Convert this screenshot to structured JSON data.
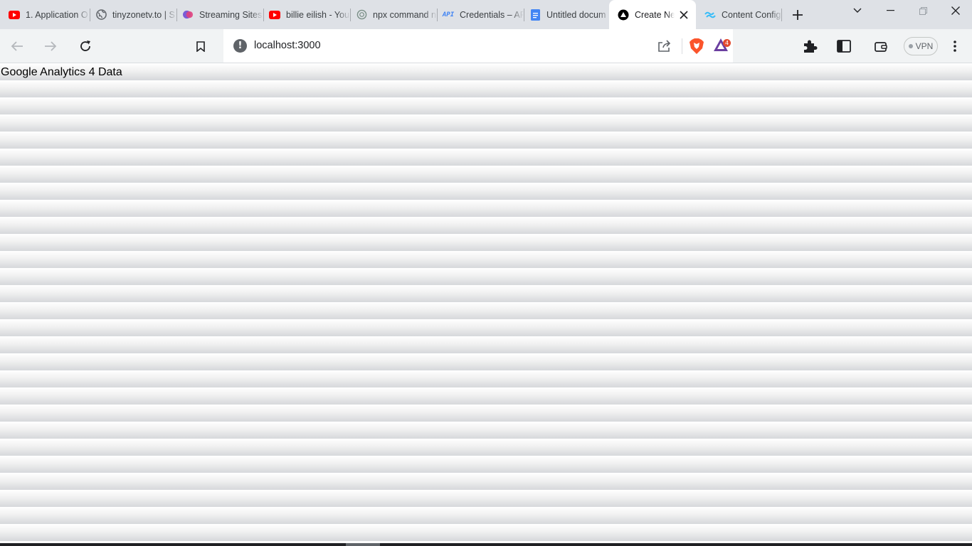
{
  "browser": {
    "tabs": [
      {
        "title": "1. Application O",
        "favicon": "youtube-icon",
        "active": false
      },
      {
        "title": "tinyzonetv.to | S",
        "favicon": "globe-icon",
        "active": false
      },
      {
        "title": "Streaming Sites",
        "favicon": "streaming-icon",
        "active": false
      },
      {
        "title": "billie eilish - You",
        "favicon": "youtube-icon",
        "active": false
      },
      {
        "title": "npx command n",
        "favicon": "chatgpt-icon",
        "active": false
      },
      {
        "title": "Credentials – AP",
        "favicon": "api-icon",
        "active": false
      },
      {
        "title": "Untitled docum",
        "favicon": "google-docs-icon",
        "active": false
      },
      {
        "title": "Create Ne",
        "favicon": "app-icon",
        "active": true
      },
      {
        "title": "Content Config",
        "favicon": "tailwind-icon",
        "active": false
      }
    ],
    "address_bar": {
      "url": "localhost:3000"
    },
    "vpn_label": "VPN",
    "rewards_badge": "4",
    "colors": {
      "tab_strip": "#dee1e6",
      "toolbar": "#f1f3f4",
      "youtube_red": "#ff0000",
      "brave_orange": "#fb542b"
    }
  },
  "page": {
    "heading": "Google Analytics 4 Data"
  }
}
